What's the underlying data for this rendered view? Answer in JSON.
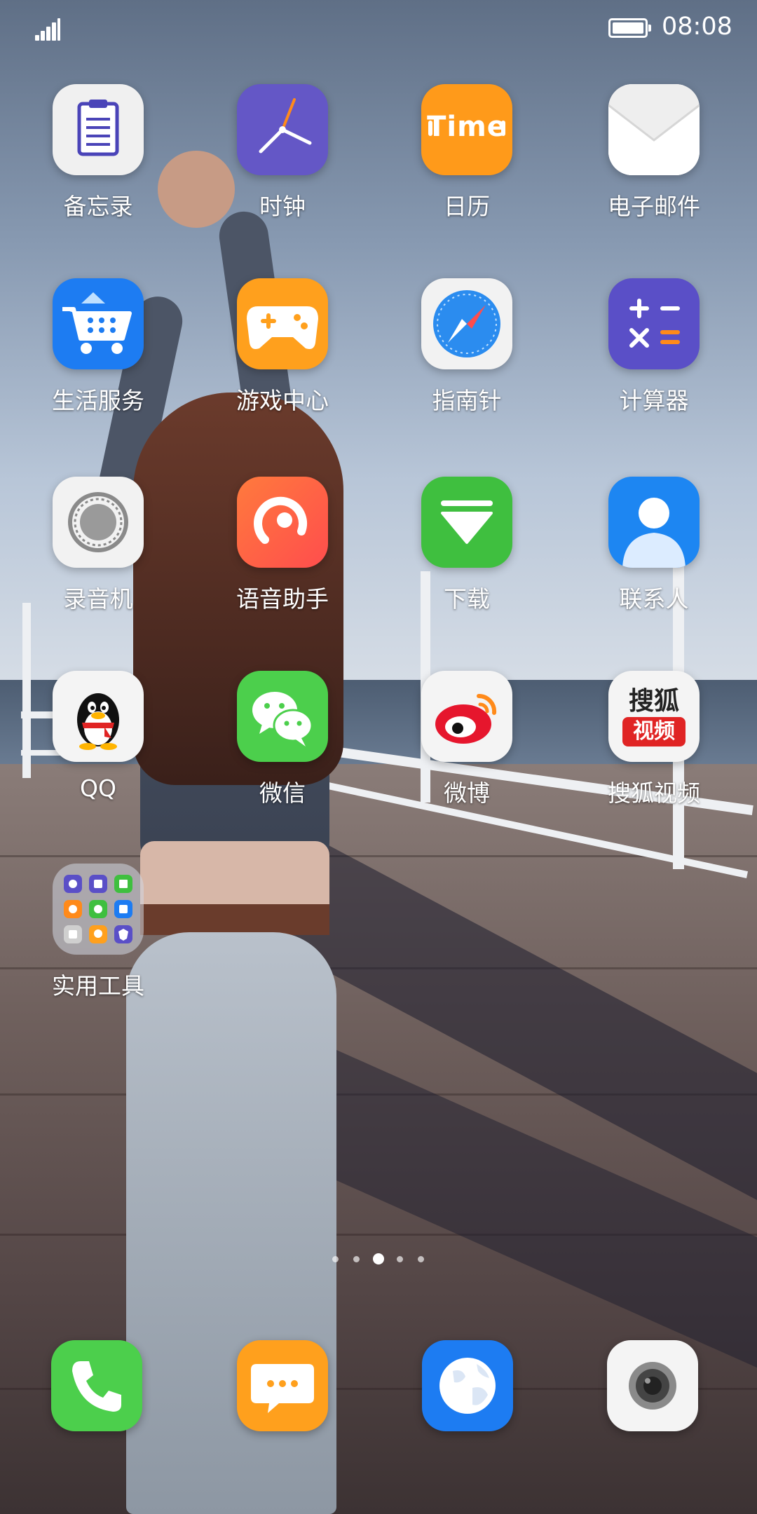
{
  "status_bar": {
    "time": "08:08",
    "signal_icon": "signal-icon",
    "battery_icon": "battery-icon"
  },
  "apps": [
    {
      "label": "备忘录",
      "icon": "memo-icon",
      "color": "#f2f2f2"
    },
    {
      "label": "时钟",
      "icon": "clock-icon",
      "color": "#6457c6"
    },
    {
      "label": "日历",
      "icon": "calendar-icon",
      "color": "#ff9a1a",
      "icon_text": "Time"
    },
    {
      "label": "电子邮件",
      "icon": "email-icon",
      "color": "#f4f4f4"
    },
    {
      "label": "生活服务",
      "icon": "shopping-cart-icon",
      "color": "#1d7cf2"
    },
    {
      "label": "游戏中心",
      "icon": "gamepad-icon",
      "color": "#ffa01d"
    },
    {
      "label": "指南针",
      "icon": "compass-icon",
      "color": "#f2f2f2"
    },
    {
      "label": "计算器",
      "icon": "calculator-icon",
      "color": "#5a4fc7"
    },
    {
      "label": "录音机",
      "icon": "recorder-icon",
      "color": "#f2f2f2"
    },
    {
      "label": "语音助手",
      "icon": "voice-assistant-icon",
      "color": "#ff6a3d"
    },
    {
      "label": "下载",
      "icon": "download-icon",
      "color": "#3fbf3f"
    },
    {
      "label": "联系人",
      "icon": "contacts-icon",
      "color": "#1d86f2"
    },
    {
      "label": "QQ",
      "icon": "qq-penguin-icon",
      "color": "#f4f4f4"
    },
    {
      "label": "微信",
      "icon": "wechat-icon",
      "color": "#4ccf4c"
    },
    {
      "label": "微博",
      "icon": "weibo-icon",
      "color": "#f4f4f4"
    },
    {
      "label": "搜狐视频",
      "icon": "sohu-video-icon",
      "color": "#f4f4f4",
      "icon_text_top": "搜狐",
      "icon_text_bottom": "视频"
    }
  ],
  "folder": {
    "label": "实用工具",
    "icon": "tools-folder-icon"
  },
  "page_indicator": {
    "count": 5,
    "active_index": 2
  },
  "dock": [
    {
      "name": "phone",
      "icon": "phone-icon",
      "color": "#4ccf4c"
    },
    {
      "name": "messages",
      "icon": "message-icon",
      "color": "#ffa01d"
    },
    {
      "name": "browser",
      "icon": "globe-icon",
      "color": "#1d7cf2"
    },
    {
      "name": "camera",
      "icon": "camera-icon",
      "color": "#f4f4f4"
    }
  ]
}
